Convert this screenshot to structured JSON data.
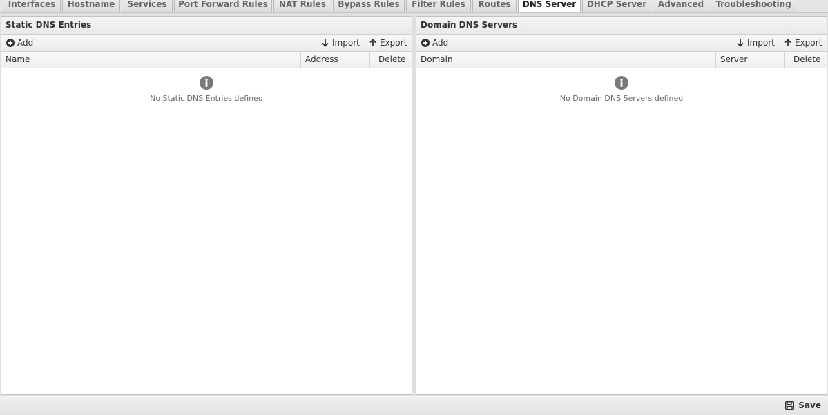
{
  "tabs": [
    {
      "label": "Interfaces",
      "active": false
    },
    {
      "label": "Hostname",
      "active": false
    },
    {
      "label": "Services",
      "active": false
    },
    {
      "label": "Port Forward Rules",
      "active": false
    },
    {
      "label": "NAT Rules",
      "active": false
    },
    {
      "label": "Bypass Rules",
      "active": false
    },
    {
      "label": "Filter Rules",
      "active": false
    },
    {
      "label": "Routes",
      "active": false
    },
    {
      "label": "DNS Server",
      "active": true
    },
    {
      "label": "DHCP Server",
      "active": false
    },
    {
      "label": "Advanced",
      "active": false
    },
    {
      "label": "Troubleshooting",
      "active": false
    }
  ],
  "static_dns": {
    "title": "Static DNS Entries",
    "add_label": "Add",
    "import_label": "Import",
    "export_label": "Export",
    "columns": [
      "Name",
      "Address",
      "Delete"
    ],
    "empty_text": "No Static DNS Entries defined"
  },
  "domain_dns": {
    "title": "Domain DNS Servers",
    "add_label": "Add",
    "import_label": "Import",
    "export_label": "Export",
    "columns": [
      "Domain",
      "Server",
      "Delete"
    ],
    "empty_text": "No Domain DNS Servers defined"
  },
  "footer": {
    "save_label": "Save"
  },
  "icons": {
    "add": "plus-circle-icon",
    "import": "arrow-down-icon",
    "export": "arrow-up-icon",
    "info": "info-circle-icon",
    "save": "floppy-disk-icon"
  },
  "colors": {
    "icon": "#333333",
    "info": "#7a7a7a"
  }
}
